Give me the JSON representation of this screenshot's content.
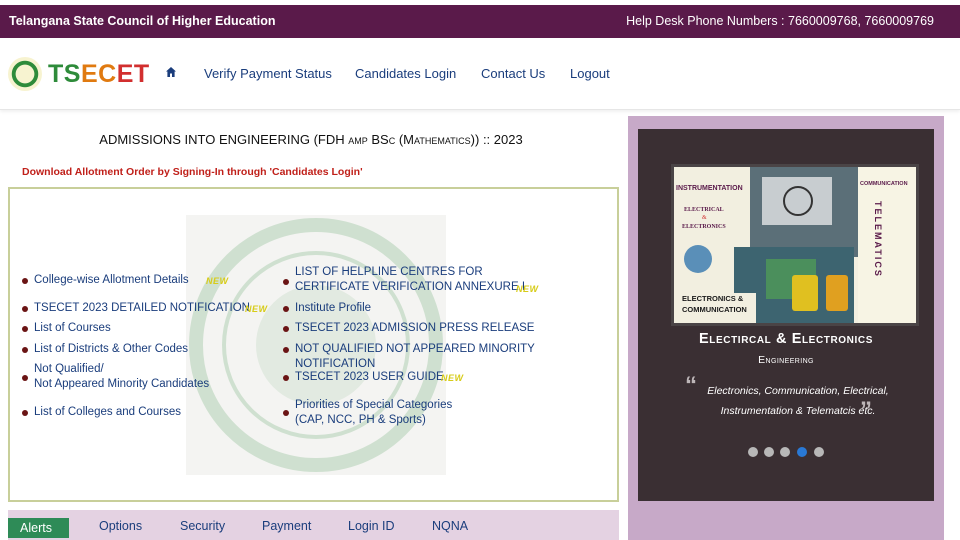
{
  "topbar": {
    "org_name": "Telangana State Council of Higher Education",
    "helpdesk": "Help Desk Phone Numbers : 7660009768, 7660009769"
  },
  "header": {
    "brand_part1": "TS",
    "brand_part2": "EC",
    "brand_part3": "ET",
    "home_icon": "home-icon",
    "nav": [
      {
        "label": "Verify Payment Status"
      },
      {
        "label": "Candidates Login"
      },
      {
        "label": "Contact Us"
      },
      {
        "label": "Logout"
      }
    ]
  },
  "main": {
    "title_prefix": "ADMISSIONS INTO ENGINEERING (FDH ",
    "title_amp": "amp",
    "title_bsc": " BSc (Mathematics)",
    "title_suffix": ") :: 2023",
    "download_notice": "Download Allotment Order by Signing-In through 'Candidates Login'",
    "new_badge": "NEW",
    "left_links": [
      {
        "line1": "College-wise Allotment Details",
        "new": true
      },
      {
        "line1": "TSECET 2023 DETAILED NOTIFICATION",
        "new": true
      },
      {
        "line1": "List of Courses"
      },
      {
        "line1": "List of Districts & Other Codes"
      },
      {
        "line1": "Not Qualified/",
        "line2": "Not Appeared Minority Candidates"
      },
      {
        "line1": "List of Colleges and Courses"
      }
    ],
    "right_links": [
      {
        "line1": "LIST OF HELPLINE CENTRES FOR",
        "line2": "CERTIFICATE VERIFICATION ANNEXURE I",
        "new": true
      },
      {
        "line1": "Institute Profile"
      },
      {
        "line1": "TSECET 2023 ADMISSION PRESS RELEASE"
      },
      {
        "line1": "NOT QUALIFIED NOT APPEARED MINORITY NOTIFICATION"
      },
      {
        "line1": "TSECET 2023 USER GUIDE",
        "new": true
      },
      {
        "line1": "Priorities of Special Categories",
        "line2": "(CAP, NCC, PH & Sports)"
      }
    ],
    "tabs": [
      {
        "label": "Alerts",
        "active": true
      },
      {
        "label": "Options"
      },
      {
        "label": "Security"
      },
      {
        "label": "Payment"
      },
      {
        "label": "Login ID"
      },
      {
        "label": "NQNA"
      }
    ]
  },
  "slider": {
    "image_labels": {
      "instrumentation": "INSTRUMENTATION",
      "electrical": "ELECTRICAL",
      "amp": "&",
      "electronics": "ELECTRONICS",
      "communication_top": "COMMUNICATION",
      "telematics": "TELEMATICS",
      "bottom1": "ELECTRONICS &",
      "bottom2": "COMMUNICATION"
    },
    "title": "Electircal & Electronics",
    "subtitle": "Engineering",
    "quote_open": "“",
    "quote_close": "”",
    "text": "Electronics, Communication, Electrical, Instrumentation & Telematcis etc.",
    "dots_total": 5,
    "active_dot": 4
  },
  "colors": {
    "topbar": "#5a1a4a",
    "nav_link": "#1a3d7c",
    "notice": "#c0201a",
    "active_tab": "#2e8b57",
    "sidebar_bg": "#c7a9c8",
    "slide_bg": "#3a2f33",
    "active_dot": "#2979d6"
  }
}
